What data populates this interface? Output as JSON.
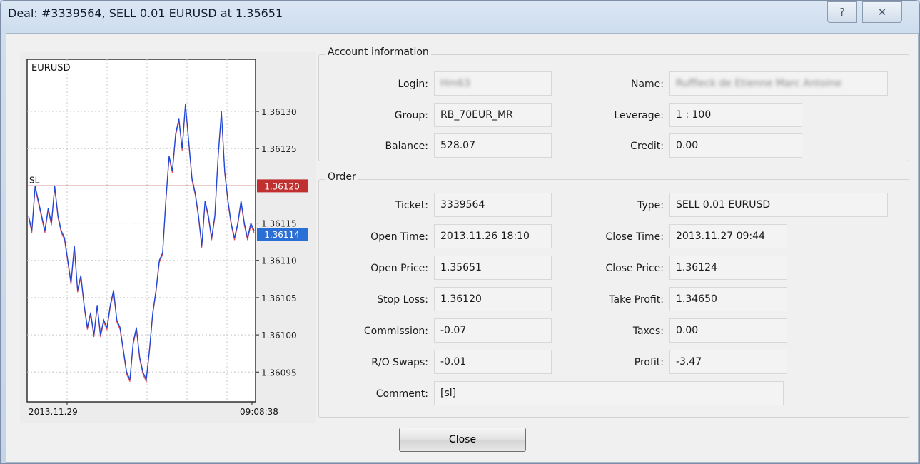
{
  "window": {
    "title": "Deal: #3339564, SELL 0.01 EURUSD at 1.35651",
    "help_glyph": "?",
    "close_glyph": "✕"
  },
  "chart": {
    "symbol": "EURUSD",
    "sl_label": "SL",
    "price_labels": [
      "1.36130",
      "1.36125",
      "1.36120",
      "1.36115",
      "1.36114",
      "1.36110",
      "1.36105",
      "1.36100",
      "1.36095"
    ],
    "current_price": "1.36114",
    "sl_price": "1.36120",
    "date_start": "2013.11.29",
    "time_end": "09:08:38",
    "colors": {
      "line": "#1f47d6",
      "bear": "#e03030",
      "sl_line": "#b83232",
      "current": "#2a6fd6",
      "sl_tag": "#c03030"
    }
  },
  "chart_data": {
    "type": "line",
    "title": "EURUSD",
    "xlabel": "",
    "ylabel": "",
    "x_start": "2013.11.29",
    "x_end": "09:08:38",
    "ylim": [
      1.36091,
      1.36137
    ],
    "yticks": [
      1.36095,
      1.361,
      1.36105,
      1.3611,
      1.36115,
      1.3612,
      1.36125,
      1.3613
    ],
    "hlines": [
      {
        "name": "SL",
        "value": 1.3612
      }
    ],
    "current": 1.36114,
    "values": [
      1.36116,
      1.36114,
      1.3612,
      1.36118,
      1.36116,
      1.36114,
      1.36117,
      1.36115,
      1.3612,
      1.36116,
      1.36114,
      1.36113,
      1.3611,
      1.36107,
      1.36112,
      1.36106,
      1.36108,
      1.36104,
      1.36101,
      1.36103,
      1.361,
      1.36104,
      1.361,
      1.36102,
      1.36101,
      1.36104,
      1.36106,
      1.36102,
      1.36101,
      1.36098,
      1.36095,
      1.36094,
      1.36099,
      1.36101,
      1.36097,
      1.36095,
      1.36094,
      1.36098,
      1.36103,
      1.36106,
      1.3611,
      1.36111,
      1.36118,
      1.36124,
      1.36122,
      1.36127,
      1.36129,
      1.36125,
      1.36131,
      1.36126,
      1.36121,
      1.36119,
      1.36116,
      1.36112,
      1.36118,
      1.36116,
      1.36113,
      1.36116,
      1.36124,
      1.3613,
      1.36122,
      1.36118,
      1.36115,
      1.36113,
      1.36115,
      1.36118,
      1.36115,
      1.36113,
      1.36115,
      1.36114
    ]
  },
  "account": {
    "title": "Account information",
    "login_label": "Login:",
    "login_value": "Hm63",
    "name_label": "Name:",
    "name_value": "Ruffieck de Etienne Marc Antoine",
    "group_label": "Group:",
    "group_value": "RB_70EUR_MR",
    "leverage_label": "Leverage:",
    "leverage_value": "1 : 100",
    "balance_label": "Balance:",
    "balance_value": "528.07",
    "credit_label": "Credit:",
    "credit_value": "0.00"
  },
  "order": {
    "title": "Order",
    "ticket_label": "Ticket:",
    "ticket_value": "3339564",
    "type_label": "Type:",
    "type_value": "SELL 0.01 EURUSD",
    "open_time_label": "Open Time:",
    "open_time_value": "2013.11.26 18:10",
    "close_time_label": "Close Time:",
    "close_time_value": "2013.11.27 09:44",
    "open_price_label": "Open Price:",
    "open_price_value": "1.35651",
    "close_price_label": "Close Price:",
    "close_price_value": "1.36124",
    "stop_loss_label": "Stop Loss:",
    "stop_loss_value": "1.36120",
    "take_profit_label": "Take Profit:",
    "take_profit_value": "1.34650",
    "commission_label": "Commission:",
    "commission_value": "-0.07",
    "taxes_label": "Taxes:",
    "taxes_value": "0.00",
    "swaps_label": "R/O Swaps:",
    "swaps_value": "-0.01",
    "profit_label": "Profit:",
    "profit_value": "-3.47",
    "comment_label": "Comment:",
    "comment_value": "[sl]"
  },
  "footer": {
    "close_label": "Close"
  }
}
